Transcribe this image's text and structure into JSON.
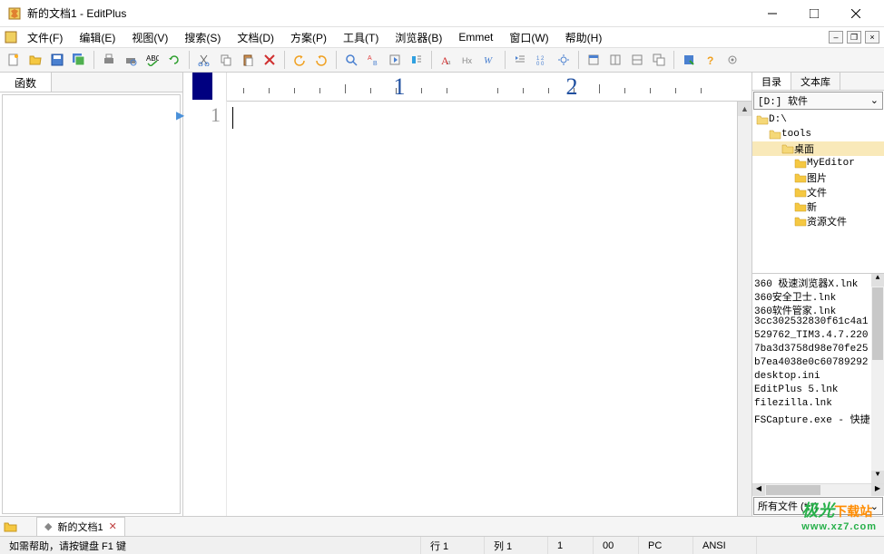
{
  "window": {
    "title": "新的文档1 - EditPlus"
  },
  "menu": {
    "file": "文件(F)",
    "edit": "编辑(E)",
    "view": "视图(V)",
    "search": "搜索(S)",
    "document": "文档(D)",
    "project": "方案(P)",
    "tools": "工具(T)",
    "browser": "浏览器(B)",
    "emmet": "Emmet",
    "window": "窗口(W)",
    "help": "帮助(H)"
  },
  "left_panel": {
    "tab": "函数"
  },
  "ruler": {
    "marks": [
      "1",
      "2"
    ]
  },
  "editor": {
    "line_number": "1"
  },
  "right_panel": {
    "tabs": {
      "dir": "目录",
      "cliptext": "文本库"
    },
    "drive": "[D:] 软件",
    "tree": [
      {
        "name": "D:\\",
        "indent": 0,
        "open": true
      },
      {
        "name": "tools",
        "indent": 1,
        "open": true
      },
      {
        "name": "桌面",
        "indent": 2,
        "open": true,
        "selected": true
      },
      {
        "name": "MyEditor",
        "indent": 3
      },
      {
        "name": "图片",
        "indent": 3
      },
      {
        "name": "文件",
        "indent": 3
      },
      {
        "name": "新",
        "indent": 3
      },
      {
        "name": "资源文件",
        "indent": 3
      }
    ],
    "files": [
      "360 极速浏览器X.lnk",
      "360安全卫士.lnk",
      "360软件管家.lnk",
      "3cc302532830f61c4a1",
      "529762_TIM3.4.7.220",
      "7ba3d3758d98e70fe25",
      "b7ea4038e0c60789292",
      "desktop.ini",
      "EditPlus 5.lnk",
      "filezilla.lnk",
      "FSCapture.exe - 快捷"
    ],
    "filter": "所有文件 (*.*)"
  },
  "doc_tabs": {
    "tab1": "新的文档1"
  },
  "status": {
    "help": "如需帮助，请按键盘 F1 键",
    "line": "行 1",
    "col": "列 1",
    "sel": "1",
    "ch": "00",
    "platform": "PC",
    "encoding": "ANSI"
  },
  "watermark": {
    "name1": "极光",
    "name2": "下载站",
    "url": "www.xz7.com"
  }
}
